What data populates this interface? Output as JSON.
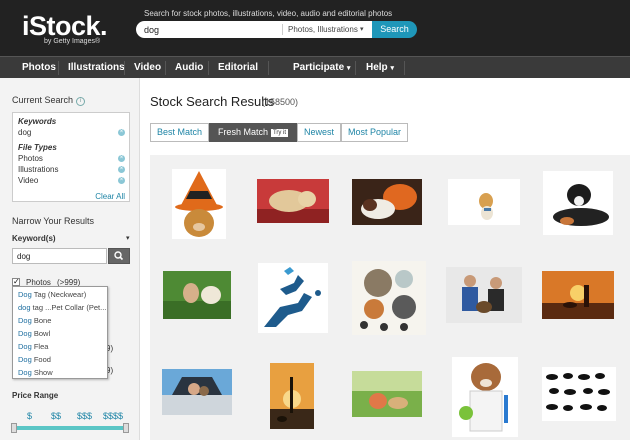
{
  "header": {
    "logo": "iStock.",
    "logo_sub": "by Getty Images®",
    "search_caption": "Search for stock photos, illustrations, video, audio and editorial photos",
    "search_value": "dog",
    "search_filter": "Photos, Illustrations",
    "search_button": "Search"
  },
  "nav": {
    "items": [
      "Photos",
      "Illustrations",
      "Video",
      "Audio",
      "Editorial",
      "Participate",
      "Help"
    ]
  },
  "sidebar": {
    "current_search_title": "Current Search",
    "keywords_label": "Keywords",
    "keyword_value": "dog",
    "file_types_label": "File Types",
    "file_types": [
      "Photos",
      "Illustrations",
      "Video"
    ],
    "clear_all": "Clear All",
    "narrow_title": "Narrow Your Results",
    "keywords_filter_label": "Keyword(s)",
    "keyword_input_value": "dog",
    "photos_label": "Photos",
    "photos_count": "(>999)",
    "hidden_counts": [
      "9)",
      "9)"
    ],
    "suggestions": [
      {
        "bold": "Dog",
        "rest": " Tag (Neckwear)"
      },
      {
        "bold": "dog",
        "rest": " tag ...Pet Collar (Pet..."
      },
      {
        "bold": "Dog",
        "rest": " Bone"
      },
      {
        "bold": "Dog",
        "rest": " Bowl"
      },
      {
        "bold": "Dog",
        "rest": " Flea"
      },
      {
        "bold": "Dog",
        "rest": " Food"
      },
      {
        "bold": "Dog",
        "rest": " Show"
      }
    ],
    "price_label": "Price Range",
    "price_ticks": [
      "$",
      "$$",
      "$$$",
      "$$$$"
    ]
  },
  "results": {
    "title": "Stock Search Results",
    "count": "(158500)",
    "tabs": [
      "Best Match",
      "Fresh Match",
      "Newest",
      "Most Popular"
    ],
    "try_badge": "Try it"
  },
  "colors": {
    "header_bg": "#222222",
    "nav_bg": "#3a3a3a",
    "accent": "#1f97b9",
    "price_track": "#5bc6c6"
  }
}
